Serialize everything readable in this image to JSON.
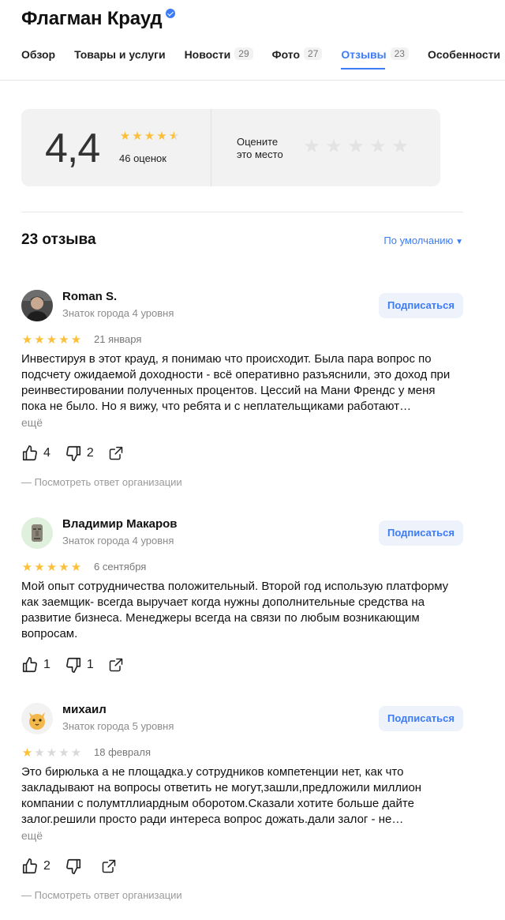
{
  "header": {
    "title": "Флагман Крауд",
    "tabs": [
      {
        "label": "Обзор",
        "count": ""
      },
      {
        "label": "Товары и услуги",
        "count": ""
      },
      {
        "label": "Новости",
        "count": "29"
      },
      {
        "label": "Фото",
        "count": "27"
      },
      {
        "label": "Отзывы",
        "count": "23",
        "active": true
      },
      {
        "label": "Особенности",
        "count": ""
      }
    ]
  },
  "summary": {
    "rating": "4,4",
    "rating_value": 4.4,
    "ratings_count": "46 оценок",
    "rate_prompt_line1": "Оцените",
    "rate_prompt_line2": "это место"
  },
  "reviews_header": {
    "count_label": "23 отзыва",
    "sort_label": "По умолчанию"
  },
  "colors": {
    "accent": "#3d7cf5",
    "star": "#fcbf3a",
    "star_empty": "#d9d9d9"
  },
  "reviews": [
    {
      "author": "Roman S.",
      "level": "Знаток города 4 уровня",
      "subscribe_label": "Подписаться",
      "rating": 5,
      "date": "21 января",
      "text": "Инвестируя в этот крауд, я понимаю что происходит. Была пара вопрос по подсчету ожидаемой доходности - всё оперативно разъяснили, это доход при реинвестировании полученных процентов. Цессий на Мани Френдс у меня пока не было. Но я вижу, что ребята и с неплательщиками работают…",
      "more_label": "ещё",
      "likes": "4",
      "dislikes": "2",
      "org_reply_label": "Посмотреть ответ организации",
      "avatar_icon": "person-photo"
    },
    {
      "author": "Владимир Макаров",
      "level": "Знаток города 4 уровня",
      "subscribe_label": "Подписаться",
      "rating": 5,
      "date": "6 сентября",
      "text": "Мой опыт сотрудничества положительный. Второй год использую платформу как заемщик- всегда выручает когда нужны дополнительные средства на развитие бизнеса. Менеджеры всегда на связи по любым возникающим вопросам.",
      "likes": "1",
      "dislikes": "1",
      "avatar_icon": "moai-icon"
    },
    {
      "author": "михаил",
      "level": "Знаток города 5 уровня",
      "subscribe_label": "Подписаться",
      "rating": 1,
      "date": "18 февраля",
      "text": "Это бирюлька а не площадка.у сотрудников компетенции нет, как что закладывают на вопросы ответить не могут,зашли,предложили миллион компании с полумтллиардным оборотом.Сказали хотите больше дайте залог.решили просто ради интереса вопрос дожать.дали залог - не…",
      "more_label": "ещё",
      "likes": "2",
      "dislikes": "",
      "org_reply_label": "Посмотреть ответ организации",
      "avatar_icon": "cat-face-icon"
    }
  ]
}
